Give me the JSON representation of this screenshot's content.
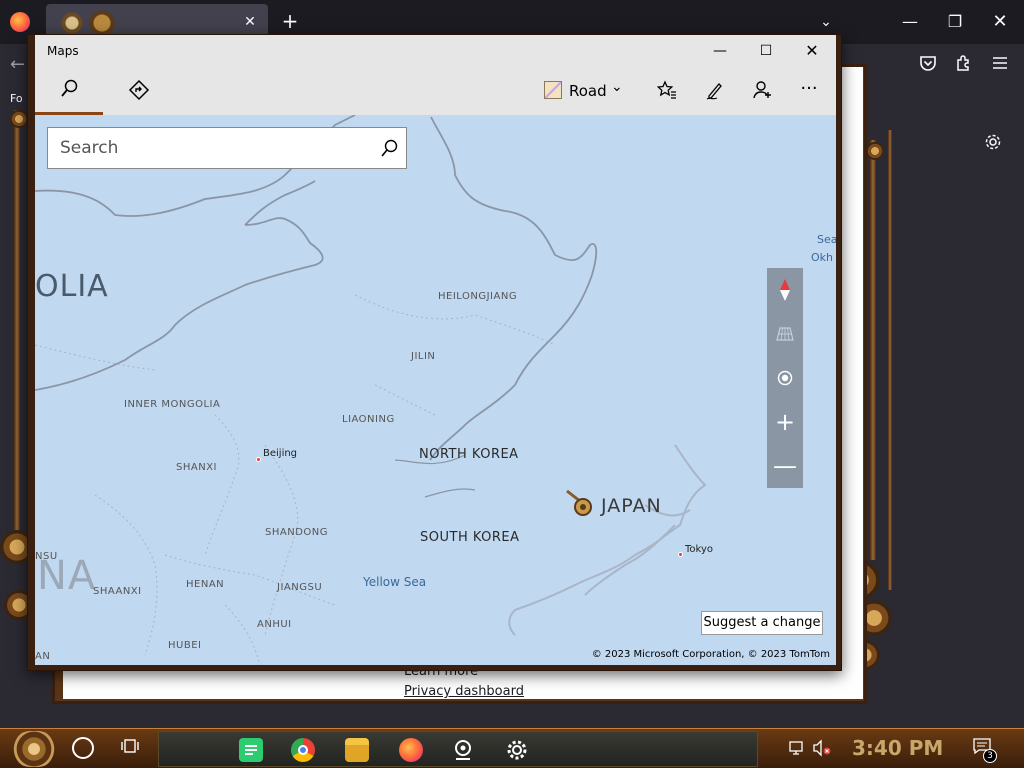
{
  "browser": {
    "tab_close": "✕",
    "new_tab": "+",
    "list_tabs": "⌄",
    "window_minimize": "—",
    "window_restore": "❐",
    "window_close": "✕",
    "back": "←",
    "partial_label": "Fo",
    "bg_page": {
      "learn_more": "Learn more",
      "privacy_dashboard": "Privacy dashboard"
    }
  },
  "maps": {
    "title": "Maps",
    "controls": {
      "minimize": "—",
      "maximize": "☐",
      "close": "✕"
    },
    "toolbar": {
      "map_style_label": "Road",
      "map_style_chevron": "⌄",
      "favorites_icon": "☆≡",
      "ink_icon": "✎",
      "account_icon": "👤",
      "more_icon": "···"
    },
    "search": {
      "placeholder": "Search"
    },
    "map_labels": {
      "mongolia": "OLIA",
      "china": "NA",
      "heilongjiang": "HEILONGJIANG",
      "jilin": "JILIN",
      "inner_mongolia": "INNER MONGOLIA",
      "liaoning": "LIAONING",
      "beijing": "Beijing",
      "shanxi": "SHANXI",
      "north_korea": "NORTH KOREA",
      "japan": "JAPAN",
      "south_korea": "SOUTH KOREA",
      "shandong": "SHANDONG",
      "tokyo": "Tokyo",
      "yellow_sea": "Yellow Sea",
      "shaanxi": "SHAANXI",
      "henan": "HENAN",
      "jiangsu": "JIANGSU",
      "anhui": "ANHUI",
      "hubei": "HUBEI",
      "nsu": "NSU",
      "an": "AN",
      "sea_okh_1": "Sea",
      "sea_okh_2": "Okh"
    },
    "map_controls": {
      "zoom_in": "+",
      "zoom_out": "—"
    },
    "suggest_change": "Suggest a change",
    "copyright": "© 2023 Microsoft Corporation, © 2023 TomTom"
  },
  "taskbar": {
    "clock": "3:40 PM",
    "notification_count": "3"
  },
  "colors": {
    "map_water": "#c0d8f0",
    "border_line": "#7a8898",
    "accent_brown": "#8b4513"
  }
}
